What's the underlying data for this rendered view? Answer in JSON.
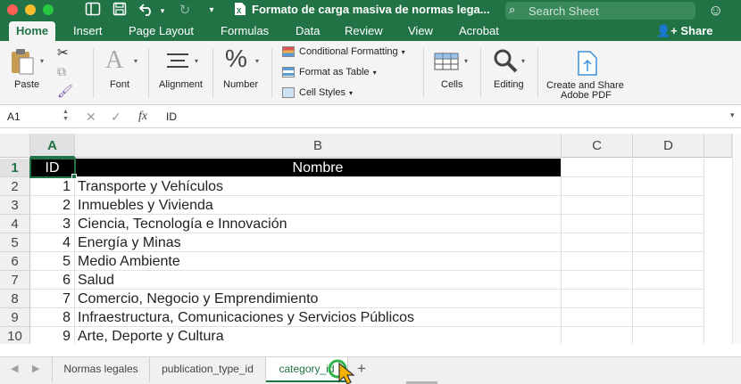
{
  "window": {
    "title": "Formato de carga masiva de normas lega...",
    "icons": [
      "sidebar-icon",
      "save-icon",
      "undo-icon",
      "redo-icon",
      "customize-toolbar-icon",
      "excel-document-icon"
    ]
  },
  "search": {
    "placeholder": "Search Sheet"
  },
  "ribbon_tabs": [
    {
      "label": "Home",
      "active": true
    },
    {
      "label": "Insert"
    },
    {
      "label": "Page Layout"
    },
    {
      "label": "Formulas"
    },
    {
      "label": "Data"
    },
    {
      "label": "Review"
    },
    {
      "label": "View"
    },
    {
      "label": "Acrobat"
    }
  ],
  "share_label": "Share",
  "ribbon": {
    "paste": "Paste",
    "font": "Font",
    "alignment": "Alignment",
    "number": "Number",
    "conditional_formatting": "Conditional Formatting",
    "format_as_table": "Format as Table",
    "cell_styles": "Cell Styles",
    "cells": "Cells",
    "editing": "Editing",
    "create_share_line1": "Create and Share",
    "create_share_line2": "Adobe PDF"
  },
  "formula_bar": {
    "name_box": "A1",
    "fx": "fx",
    "value": "ID"
  },
  "columns": [
    "A",
    "B",
    "C",
    "D"
  ],
  "rows": [
    "1",
    "2",
    "3",
    "4",
    "5",
    "6",
    "7",
    "8",
    "9",
    "10"
  ],
  "table": {
    "header": {
      "id": "ID",
      "name": "Nombre"
    },
    "data": [
      {
        "id": "1",
        "name": "Transporte y Vehículos"
      },
      {
        "id": "2",
        "name": "Inmuebles y Vivienda"
      },
      {
        "id": "3",
        "name": "Ciencia, Tecnología e Innovación"
      },
      {
        "id": "4",
        "name": "Energía y Minas"
      },
      {
        "id": "5",
        "name": "Medio Ambiente"
      },
      {
        "id": "6",
        "name": "Salud"
      },
      {
        "id": "7",
        "name": "Comercio, Negocio y Emprendimiento"
      },
      {
        "id": "8",
        "name": "Infraestructura, Comunicaciones y Servicios Públicos"
      },
      {
        "id": "9",
        "name": "Arte, Deporte y Cultura"
      }
    ]
  },
  "sheet_tabs": [
    {
      "label": "Normas legales",
      "active": false
    },
    {
      "label": "publication_type_id",
      "active": false
    },
    {
      "label": "category_id",
      "active": true
    }
  ],
  "colors": {
    "accent": "#217346",
    "header_fill": "#000000",
    "header_text": "#ffffff"
  }
}
